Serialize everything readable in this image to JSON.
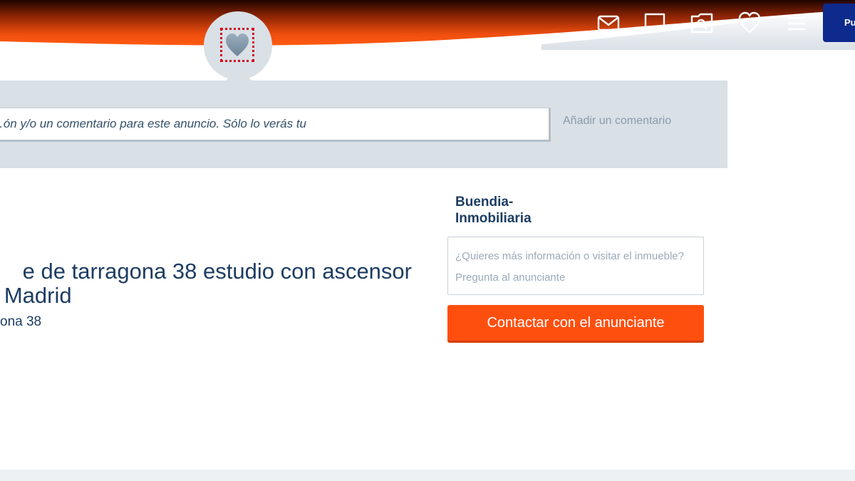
{
  "header": {
    "icons": [
      {
        "name": "mail-icon",
        "color": "#ffffff"
      },
      {
        "name": "chat-icon",
        "color": "#ffffff"
      },
      {
        "name": "saved-search-icon",
        "color": "#ffffff"
      },
      {
        "name": "heart-icon",
        "color": "#ffffff"
      },
      {
        "name": "menu-icon",
        "color": "#ffffff"
      }
    ],
    "publish_label": "Pu",
    "gradient_colors": [
      "#2a0700",
      "#e24a0c",
      "#ff5a12"
    ],
    "favourite_icon": "heart-icon"
  },
  "comment": {
    "placeholder": "…ón y/o un comentario para este anuncio. Sólo lo verás tu",
    "add_label": "Añadir un comentario"
  },
  "listing": {
    "title_line1": "e de tarragona 38 estudio con ascensor",
    "title_line2": "n Madrid",
    "address": "ona 38"
  },
  "contact": {
    "agent_name": "Buendia-Inmobiliaria",
    "message_placeholder": "¿Quieres más información o visitar el inmueble? Pregunta al anunciante",
    "button_label": "Contactar con el anunciante",
    "button_color": "#ff4f0f"
  },
  "colors": {
    "band": "#d9e0e6",
    "text_dark": "#1d3d63",
    "publish_bg": "#0d2a8c"
  }
}
